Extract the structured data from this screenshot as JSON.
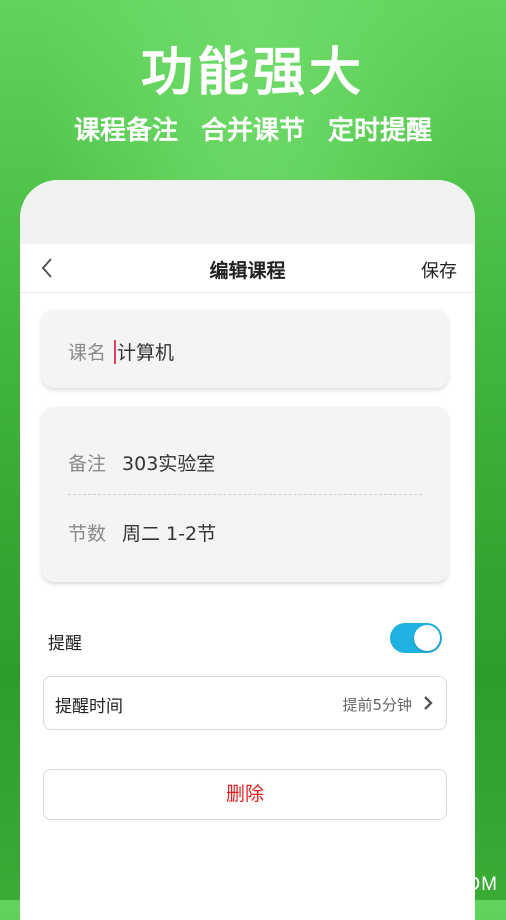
{
  "promo": {
    "title": "功能强大",
    "subtitle": "课程备注  合并课节  定时提醒"
  },
  "navbar": {
    "back_icon": "chevron-left-icon",
    "title": "编辑课程",
    "save_label": "保存"
  },
  "course_name": {
    "label": "课名",
    "value": "计算机"
  },
  "details": {
    "note_label": "备注",
    "note_value": "303实验室",
    "period_label": "节数",
    "period_value": "周二 1-2节"
  },
  "reminder": {
    "label": "提醒",
    "enabled": true,
    "toggle_color": "#1fb1e0",
    "time_label": "提醒时间",
    "time_value": "提前5分钟",
    "chevron_icon": "chevron-right-icon"
  },
  "delete_label": "删除",
  "watermark": "QQTF.COM",
  "colors": {
    "accent": "#1fb1e0",
    "danger": "#e02020",
    "background": "#41b53b"
  }
}
